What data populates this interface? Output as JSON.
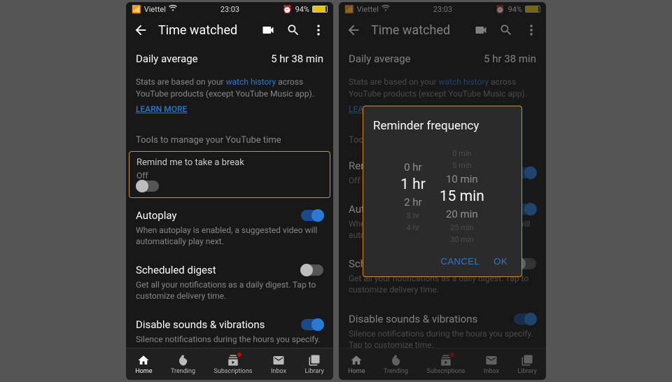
{
  "status": {
    "carrier": "Viettel",
    "time": "23:03",
    "battery_pct": "94%"
  },
  "app_bar": {
    "title": "Time watched"
  },
  "daily_avg": {
    "label": "Daily average",
    "value": "5 hr 38 min"
  },
  "stats_text_prefix": "Stats are based on your ",
  "stats_link": "watch history",
  "stats_text_suffix": " across YouTube products (except YouTube Music app).",
  "learn_more": "LEARN MORE",
  "tools_header": "Tools to manage your YouTube time",
  "settings": {
    "break": {
      "title": "Remind me to take a break",
      "sub": "Off"
    },
    "autoplay": {
      "title": "Autoplay",
      "sub": "When autoplay is enabled, a suggested video will automatically play next."
    },
    "digest": {
      "title": "Scheduled digest",
      "sub": "Get all your notifications as a daily digest. Tap to customize delivery time."
    },
    "disable_sv": {
      "title": "Disable sounds & vibrations",
      "sub": "Silence notifications during the hours you specify. Tap to customize time."
    }
  },
  "nav": {
    "home": "Home",
    "trending": "Trending",
    "subs": "Subscriptions",
    "inbox": "Inbox",
    "library": "Library"
  },
  "dialog": {
    "title": "Reminder frequency",
    "hours": {
      "far_up": "",
      "near_up": "0 hr",
      "sel": "1 hr",
      "near_dn": "2 hr",
      "far_dn": "3 hr",
      "far_dn2": "4 hr"
    },
    "mins": {
      "far_up": "0 min",
      "far_up2": "5 min",
      "near_up": "10 min",
      "sel": "15 min",
      "near_dn": "20 min",
      "far_dn": "25 min",
      "far_dn2": "30 min"
    },
    "cancel": "CANCEL",
    "ok": "OK"
  }
}
